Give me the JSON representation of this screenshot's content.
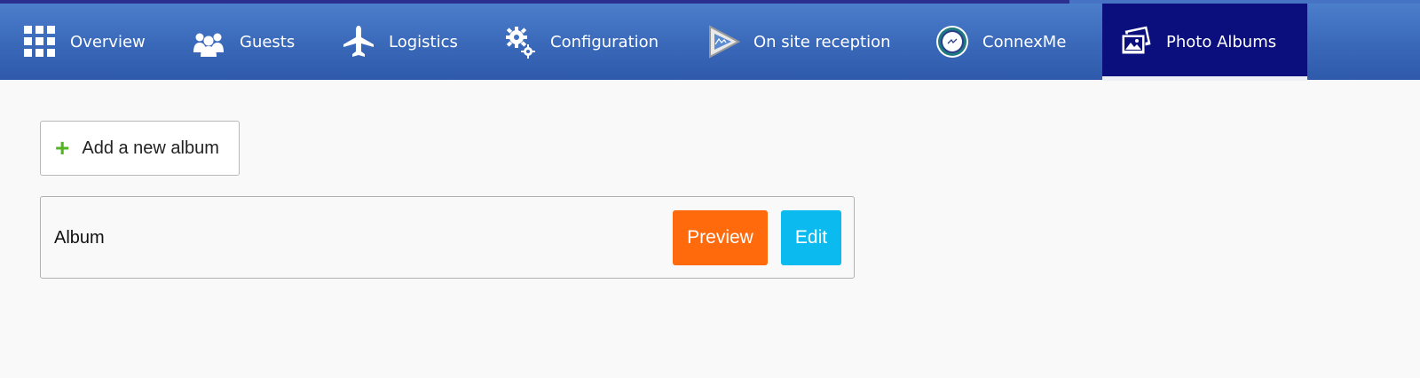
{
  "nav": {
    "items": [
      {
        "label": "Overview",
        "icon": "grid-icon"
      },
      {
        "label": "Guests",
        "icon": "people-icon"
      },
      {
        "label": "Logistics",
        "icon": "airplane-icon"
      },
      {
        "label": "Configuration",
        "icon": "gears-icon"
      },
      {
        "label": "On site reception",
        "icon": "play-triangle-icon"
      },
      {
        "label": "ConnexMe",
        "icon": "connexme-logo-icon"
      },
      {
        "label": "Photo Albums",
        "icon": "photos-icon",
        "active": true
      }
    ]
  },
  "main": {
    "add_button_label": "Add a new album",
    "albums": [
      {
        "name": "Album",
        "preview_label": "Preview",
        "edit_label": "Edit"
      }
    ]
  },
  "colors": {
    "nav_gradient_top": "#4b7ecb",
    "nav_gradient_bottom": "#2f5aab",
    "active_tab": "#0b0f7e",
    "plus": "#54b424",
    "preview": "#ff6a0d",
    "edit": "#0bbbef",
    "background": "#f9f9f9"
  }
}
